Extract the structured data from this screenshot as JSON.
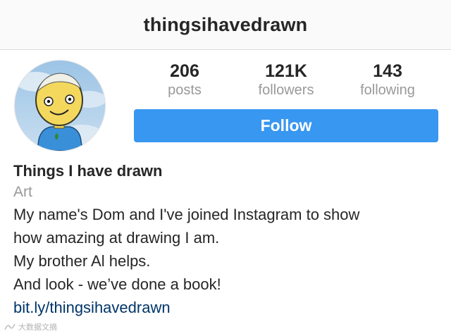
{
  "header": {
    "username": "thingsihavedrawn"
  },
  "profile": {
    "avatar_icon": "cartoon-face-avatar",
    "stats": [
      {
        "value": "206",
        "label": "posts"
      },
      {
        "value": "121K",
        "label": "followers"
      },
      {
        "value": "143",
        "label": "following"
      }
    ],
    "follow_label": "Follow",
    "follow_color": "#3897f0"
  },
  "bio": {
    "name": "Things I have drawn",
    "category": "Art",
    "lines": [
      "My name's Dom and I've joined Instagram to show",
      "how amazing at drawing I am.",
      "My brother Al helps.",
      "And look - we’ve done a book!"
    ],
    "link": "bit.ly/thingsihavedrawn",
    "link_color": "#003569"
  },
  "watermark": {
    "text": "大数据文摘"
  }
}
